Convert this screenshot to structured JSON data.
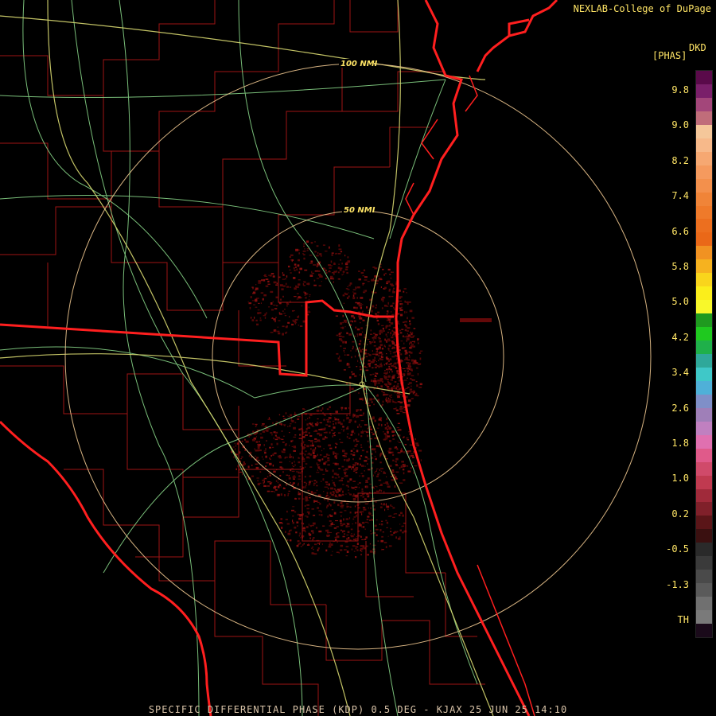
{
  "header": {
    "credit": "NEXLAB-College of DuPage"
  },
  "colorbar": {
    "title_line1": "DKD",
    "title_line2": "[PHAS]",
    "ticks": [
      "9.8",
      "9.0",
      "8.2",
      "7.4",
      "6.6",
      "5.8",
      "5.0",
      "4.2",
      "3.4",
      "2.6",
      "1.8",
      "1.0",
      "0.2",
      "-0.5",
      "-1.3",
      "TH"
    ],
    "segments": [
      {
        "color": "#5a0a4a"
      },
      {
        "color": "#7a1f6a"
      },
      {
        "color": "#a3467a"
      },
      {
        "color": "#c06d7a"
      },
      {
        "color": "#f5c79a"
      },
      {
        "color": "#f7b98a"
      },
      {
        "color": "#f6a872"
      },
      {
        "color": "#f59a5e"
      },
      {
        "color": "#f3904c"
      },
      {
        "color": "#f08438"
      },
      {
        "color": "#ef7a2a"
      },
      {
        "color": "#ec6f1f"
      },
      {
        "color": "#ea6818"
      },
      {
        "color": "#f19222"
      },
      {
        "color": "#f6b21f"
      },
      {
        "color": "#f9d51c"
      },
      {
        "color": "#fbee1b"
      },
      {
        "color": "#f8f82a"
      },
      {
        "color": "#1f9a1f"
      },
      {
        "color": "#1fc91f"
      },
      {
        "color": "#1fb04a"
      },
      {
        "color": "#2fa89a"
      },
      {
        "color": "#3fc8c8"
      },
      {
        "color": "#4fb0d8"
      },
      {
        "color": "#7f8fc8"
      },
      {
        "color": "#9f7fb8"
      },
      {
        "color": "#c080c0"
      },
      {
        "color": "#e070b0"
      },
      {
        "color": "#e05a8a"
      },
      {
        "color": "#d04a6a"
      },
      {
        "color": "#c03a50"
      },
      {
        "color": "#a02a3a"
      },
      {
        "color": "#80202a"
      },
      {
        "color": "#5a1518"
      },
      {
        "color": "#3a1010"
      },
      {
        "color": "#2a2a2a"
      },
      {
        "color": "#3a3a3a"
      },
      {
        "color": "#4a4a4a"
      },
      {
        "color": "#5a5a5a"
      },
      {
        "color": "#707070"
      },
      {
        "color": "#7a7a7a"
      },
      {
        "color": "#1a0a1a"
      }
    ]
  },
  "map": {
    "ring_labels": [
      "100 NMI",
      "50 NMI"
    ],
    "colors": {
      "state_border": "#ff1a1a",
      "county_border": "#c81e1e",
      "coast": "#ff1a1a",
      "highway_green": "#8fe08f",
      "highway_yellow": "#e0e070",
      "range_ring": "#f0c890",
      "echo": "#6a0a0a"
    }
  },
  "footer": {
    "caption": "SPECIFIC DIFFERENTIAL PHASE (KDP) 0.5 DEG - KJAX 25 JUN 25 14:10"
  }
}
